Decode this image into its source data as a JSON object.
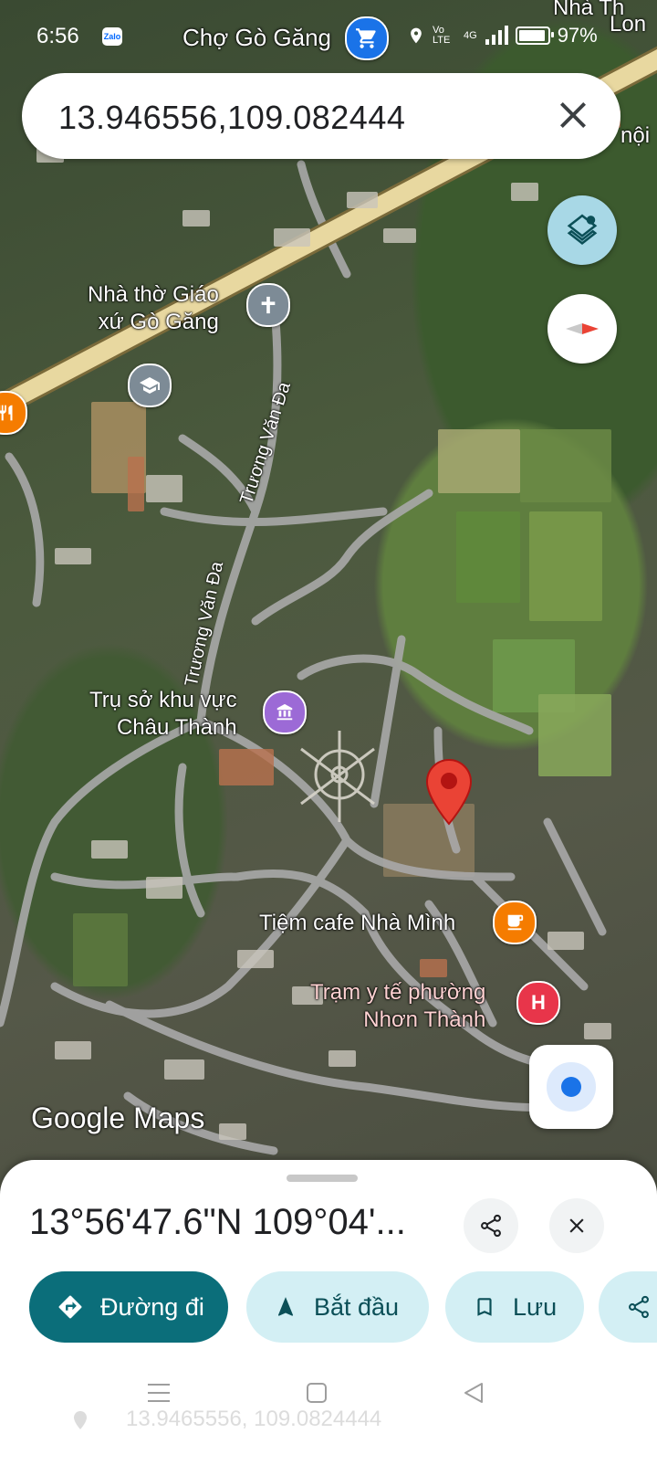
{
  "status_bar": {
    "time": "6:56",
    "zalo_label": "Zalo",
    "network": "Vo LTE",
    "signal": "4G",
    "battery_pct": "97%"
  },
  "search": {
    "query": "13.946556,109.082444"
  },
  "map": {
    "places": {
      "market": "Chợ Gò Găng",
      "church_line1": "Nhà thờ Giáo",
      "church_line2": "xứ Gò Găng",
      "office_line1": "Trụ sở khu vực",
      "office_line2": "Châu Thành",
      "cafe": "Tiệm cafe Nhà Mình",
      "clinic_line1": "Trạm y tế phường",
      "clinic_line2": "Nhơn Thành",
      "edge_top_right_1": "Nhà Th",
      "edge_top_right_2": "Lon",
      "edge_right": "nội"
    },
    "roads": {
      "road_a": "Trương Văn Đa",
      "road_b": "Trương Văn Đa"
    },
    "logo": "Google Maps"
  },
  "sheet": {
    "title": "13°56'47.6\"N 109°04'...",
    "buttons": {
      "directions": "Đường đi",
      "start": "Bắt đầu",
      "save": "Lưu"
    },
    "ghost_text": "13.9465556, 109.0824444"
  },
  "colors": {
    "primary_button": "#0b6e7a",
    "secondary_button": "#d3eff4",
    "pin": "#ea4335",
    "road_main": "#e8d8a0"
  }
}
